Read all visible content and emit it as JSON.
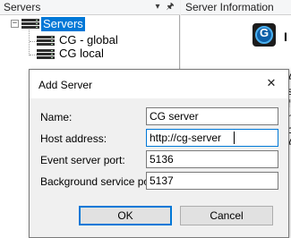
{
  "servers_pane": {
    "title": "Servers",
    "dropdown_glyph": "▾",
    "pin_glyph": "🖈",
    "tree": {
      "expander_glyph": "−",
      "root_label": "Servers",
      "children": [
        {
          "label": "CG - global"
        },
        {
          "label": "CG local"
        }
      ]
    }
  },
  "info_pane": {
    "title": "Server Information",
    "logo_letter": "G",
    "logo_icon": "app-logo-icon",
    "truncated_heading": "I",
    "side_letters": [
      "A",
      "s",
      "f",
      "n",
      "c",
      "A"
    ]
  },
  "dialog": {
    "title": "Add Server",
    "close_glyph": "✕",
    "fields": {
      "name": {
        "label": "Name:",
        "value": "CG server"
      },
      "host": {
        "label": "Host address:",
        "value": "http://cg-server"
      },
      "event_port": {
        "label": "Event server port:",
        "value": "5136"
      },
      "bg_port": {
        "label": "Background service port:",
        "value": "5137"
      }
    },
    "ok_label": "OK",
    "cancel_label": "Cancel"
  },
  "colors": {
    "selection": "#0078d7",
    "focus_border": "#0078d7",
    "dialog_body": "#f0f0f0"
  }
}
